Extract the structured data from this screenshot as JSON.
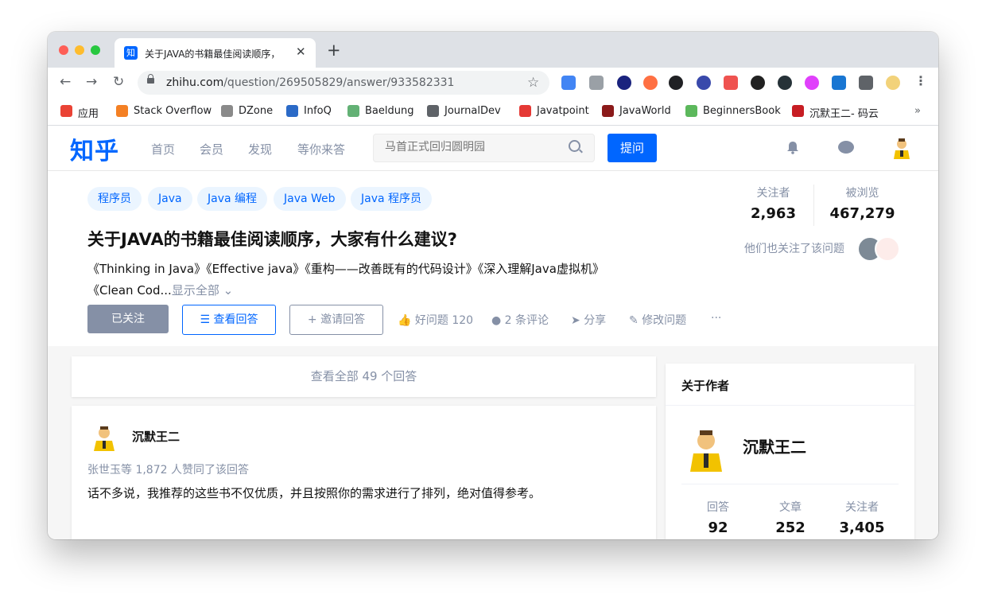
{
  "browser": {
    "tab_title": "关于JAVA的书籍最佳阅读顺序，",
    "tab_favicon": "知",
    "url_host": "zhihu.com",
    "url_path": "/question/269505829/answer/933582331",
    "bookmarks": [
      {
        "label": "应用",
        "icon": "apps-grid-icon",
        "color": "#ea4335"
      },
      {
        "label": "Stack Overflow",
        "icon": "stack-overflow-icon",
        "color": "#f48024"
      },
      {
        "label": "DZone",
        "icon": "dzone-icon",
        "color": "#8a8a8a"
      },
      {
        "label": "InfoQ",
        "icon": "infoq-icon",
        "color": "#2b6ac7"
      },
      {
        "label": "Baeldung",
        "icon": "baeldung-icon",
        "color": "#63b175"
      },
      {
        "label": "JournalDev",
        "icon": "globe-icon",
        "color": "#5f6368"
      },
      {
        "label": "Javatpoint",
        "icon": "javatpoint-icon",
        "color": "#e53935"
      },
      {
        "label": "JavaWorld",
        "icon": "javaworld-icon",
        "color": "#8b1a1a"
      },
      {
        "label": "BeginnersBook",
        "icon": "beginnersbook-icon",
        "color": "#5cb85c"
      },
      {
        "label": "沉默王二- 码云",
        "icon": "gitee-icon",
        "color": "#c71d23"
      }
    ],
    "bookmarks_more": "»"
  },
  "header": {
    "logo": "知乎",
    "nav": [
      "首页",
      "会员",
      "发现",
      "等你来答"
    ],
    "search_placeholder": "马首正式回归圆明园",
    "ask_label": "提问",
    "brand_color": "#0066ff"
  },
  "question": {
    "tags": [
      "程序员",
      "Java",
      "Java 编程",
      "Java Web",
      "Java 程序员"
    ],
    "title": "关于JAVA的书籍最佳阅读顺序，大家有什么建议?",
    "excerpt_line1": "《Thinking in Java》《Effective java》《重构——改善既有的代码设计》《深入理解Java虚拟机》",
    "excerpt_line2": "《Clean Cod...",
    "show_all": "显示全部",
    "followers_label": "关注者",
    "followers_value": "2,963",
    "views_label": "被浏览",
    "views_value": "467,279",
    "also_followed": "他们也关注了该问题",
    "actions": {
      "follow": "已关注",
      "view_answers": "查看回答",
      "invite": "邀请回答",
      "good_question": "好问题 120",
      "comments": "2 条评论",
      "share": "分享",
      "edit": "修改问题",
      "more": "···"
    }
  },
  "answers": {
    "view_all": "查看全部 49 个回答",
    "first": {
      "author": "沉默王二",
      "votes": "张世玉等 1,872 人赞同了该回答",
      "text": "话不多说，我推荐的这些书不仅优质，并且按照你的需求进行了排列，绝对值得参考。"
    }
  },
  "author_card": {
    "heading": "关于作者",
    "name": "沉默王二",
    "stats": [
      {
        "label": "回答",
        "value": "92"
      },
      {
        "label": "文章",
        "value": "252"
      },
      {
        "label": "关注者",
        "value": "3,405"
      }
    ]
  }
}
